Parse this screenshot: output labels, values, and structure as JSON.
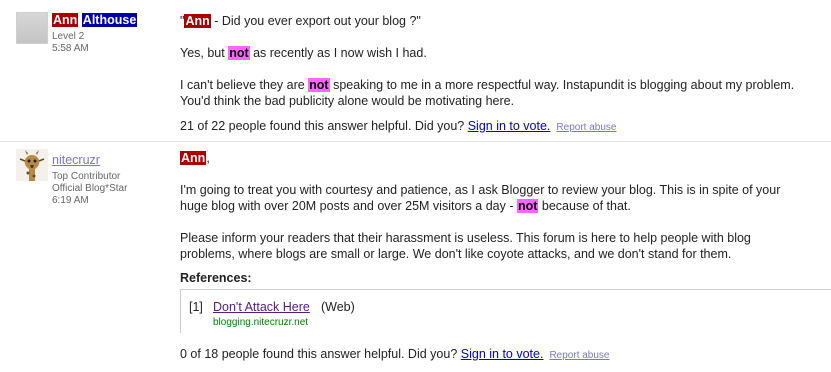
{
  "post1": {
    "user_first": "Ann",
    "user_last": "Althouse",
    "level": "Level 2",
    "time": "5:58 AM",
    "quote_open": "\"",
    "quote_hl": "Ann",
    "quote_rest": " - Did you ever export out your blog ?\"",
    "p2_a": "Yes, but ",
    "p2_hl": "not",
    "p2_b": " as recently as I now wish I had.",
    "p3_a": "I can't believe they are ",
    "p3_hl": "not",
    "p3_b": " speaking to me in a more respectful way. Instapundit is blogging about my problem.",
    "p3_line2": "You'd think the bad publicity alone would be motivating here.",
    "helpful": "21 of 22 people found this answer helpful. Did you? ",
    "vote_link": "Sign in to vote.",
    "report": "Report abuse"
  },
  "post2": {
    "user": "nitecruzr",
    "role1": "Top Contributor",
    "role2": "Official Blog*Star",
    "time": "6:19 AM",
    "greet_hl": "Ann",
    "greet_punct": ",",
    "p2_line1": "I'm going to treat you with courtesy and patience, as I ask Blogger to review your blog.  This is in spite of your",
    "p2_line2a": "huge blog with over 20M posts and over 25M visitors a day - ",
    "p2_hl": "not",
    "p2_line2b": " because of that.",
    "p3_line1": "Please inform your readers that their harassment is useless.  This forum is here to help people with blog",
    "p3_line2": "problems, where blogs are small or large.  We don't like coyote attacks, and we don't stand for them.",
    "references_heading": "References:",
    "ref_num": "[1]",
    "ref_link": "Don't Attack Here",
    "ref_type": "(Web)",
    "ref_url": "blogging.nitecruzr.net",
    "helpful": "0 of 18 people found this answer helpful. Did you? ",
    "vote_link": "Sign in to vote.",
    "report": "Report abuse"
  }
}
